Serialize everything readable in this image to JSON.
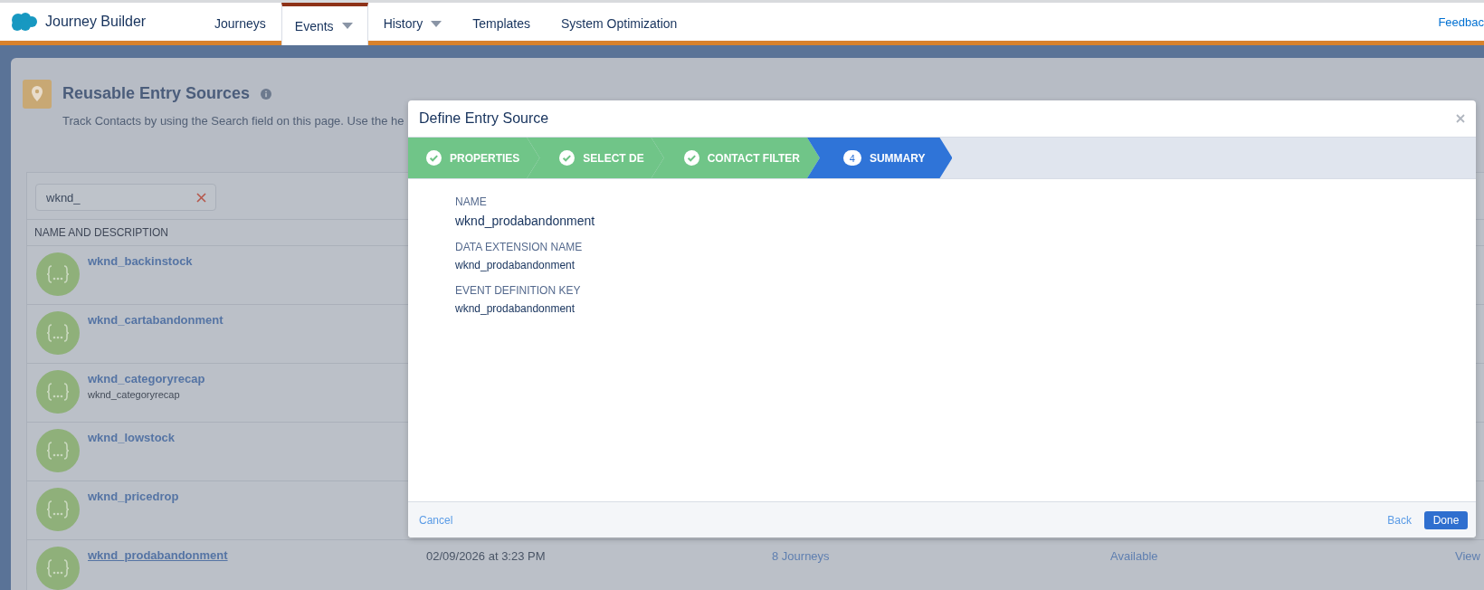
{
  "app": {
    "title": "Journey Builder"
  },
  "nav": [
    {
      "label": "Journeys",
      "dropdown": false,
      "selected": false
    },
    {
      "label": "Events",
      "dropdown": true,
      "selected": true
    },
    {
      "label": "History",
      "dropdown": true,
      "selected": false
    },
    {
      "label": "Templates",
      "dropdown": false,
      "selected": false
    },
    {
      "label": "System Optimization",
      "dropdown": false,
      "selected": false
    }
  ],
  "feedback": "Feedbac",
  "page": {
    "title": "Reusable Entry Sources",
    "description": "Track Contacts by using the Search field on this page. Use the he"
  },
  "search": {
    "value": "wknd_"
  },
  "table": {
    "columns": [
      "NAME AND DESCRIPTION"
    ],
    "rows": [
      {
        "name": "wknd_backinstock",
        "hovered": false
      },
      {
        "name": "wknd_cartabandonment",
        "hovered": false
      },
      {
        "name": "wknd_categoryrecap",
        "description": "wknd_categoryrecap",
        "hovered": false
      },
      {
        "name": "wknd_lowstock",
        "hovered": false
      },
      {
        "name": "wknd_pricedrop",
        "hovered": false
      },
      {
        "name": "wknd_prodabandonment",
        "hovered": true,
        "date": "02/09/2026 at 3:23 PM",
        "journeys": "8 Journeys",
        "status": "Available",
        "action": "View"
      }
    ]
  },
  "modal": {
    "title": "Define Entry Source",
    "steps": [
      {
        "label": "PROPERTIES",
        "complete": true,
        "selected": false
      },
      {
        "label": "SELECT DE",
        "complete": true,
        "selected": false
      },
      {
        "label": "CONTACT FILTER",
        "complete": true,
        "selected": false
      },
      {
        "label": "SUMMARY",
        "complete": false,
        "selected": true,
        "number": "4"
      }
    ],
    "fields": [
      {
        "label": "NAME",
        "value": "wknd_prodabandonment",
        "kind": "large"
      },
      {
        "label": "DATA EXTENSION NAME",
        "value": "wknd_prodabandonment",
        "kind": "small"
      },
      {
        "label": "EVENT DEFINITION KEY",
        "value": "wknd_prodabandonment",
        "kind": "small"
      }
    ],
    "cancel": "Cancel",
    "back": "Back",
    "done": "Done"
  }
}
